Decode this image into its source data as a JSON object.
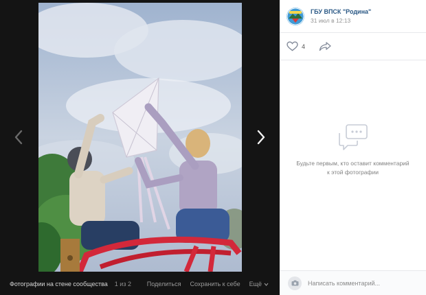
{
  "viewer": {
    "album_label": "Фотографии на стене сообщества",
    "counter": "1 из 2",
    "actions": {
      "share": "Поделиться",
      "save": "Сохранить к себе",
      "more": "Ещё"
    },
    "icons": {
      "prev": "chevron-left-icon",
      "next": "chevron-right-icon"
    }
  },
  "post": {
    "owner_name": "ГБУ ВПСК \"Родина\"",
    "date": "31 июл в 12:13",
    "likes_count": "4",
    "empty_comments_text": "Будьте первым, кто оставит комментарий к этой фотографии",
    "comment_placeholder": "Написать комментарий..."
  },
  "colors": {
    "link": "#2a5885",
    "viewer_bg": "#141414",
    "panel_bg": "#ffffff"
  }
}
